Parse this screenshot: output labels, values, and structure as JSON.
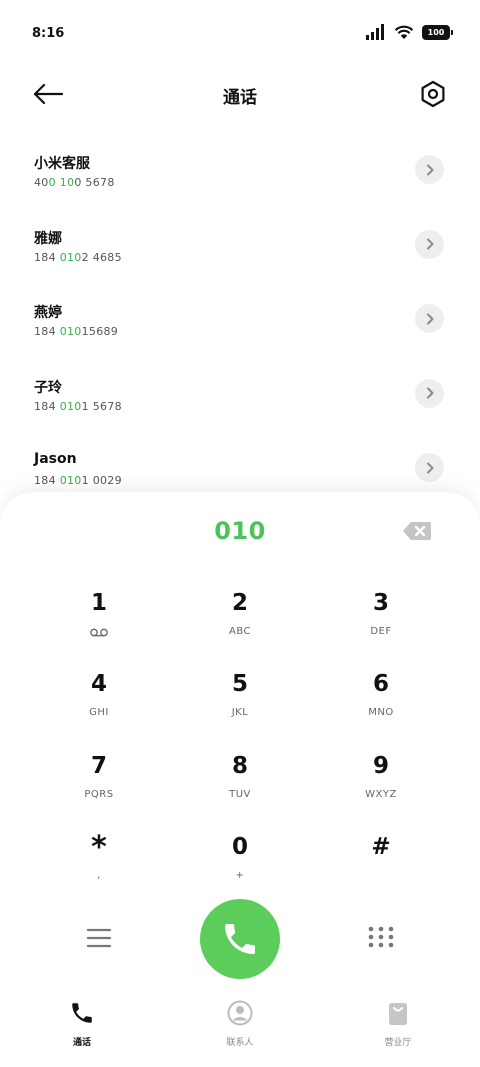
{
  "status_bar": {
    "time": "8:16",
    "battery": "100"
  },
  "header": {
    "title": "通话"
  },
  "contacts": [
    {
      "name": "小米客服",
      "number_parts": [
        "40",
        "0",
        " ",
        "10",
        "0 5678"
      ]
    },
    {
      "name": "雅娜",
      "number_parts": [
        "184 ",
        "010",
        "2 4685"
      ]
    },
    {
      "name": "燕婷",
      "number_parts": [
        "184 ",
        "010",
        "15689"
      ]
    },
    {
      "name": "子玲",
      "number_parts": [
        "184 ",
        "010",
        "1 5678"
      ]
    },
    {
      "name": "Jason",
      "number_parts": [
        "184 ",
        "010",
        "1 0029"
      ]
    }
  ],
  "dialer": {
    "input": "010",
    "keys": [
      {
        "digit": "1",
        "letters": ""
      },
      {
        "digit": "2",
        "letters": "ABC"
      },
      {
        "digit": "3",
        "letters": "DEF"
      },
      {
        "digit": "4",
        "letters": "GHI"
      },
      {
        "digit": "5",
        "letters": "JKL"
      },
      {
        "digit": "6",
        "letters": "MNO"
      },
      {
        "digit": "7",
        "letters": "PQRS"
      },
      {
        "digit": "8",
        "letters": "TUV"
      },
      {
        "digit": "9",
        "letters": "WXYZ"
      },
      {
        "digit": "*",
        "letters": ","
      },
      {
        "digit": "0",
        "letters": "+"
      },
      {
        "digit": "#",
        "letters": ""
      }
    ]
  },
  "bottom_nav": {
    "items": [
      {
        "label": "通话",
        "icon": "phone-icon",
        "active": true
      },
      {
        "label": "联系人",
        "icon": "person-icon",
        "active": false
      },
      {
        "label": "营业厅",
        "icon": "shopping-bag-icon",
        "active": false
      }
    ]
  },
  "colors": {
    "accent_green": "#4cc35a",
    "call_button": "#5ccd5b",
    "highlight_text": "#35b34a"
  }
}
